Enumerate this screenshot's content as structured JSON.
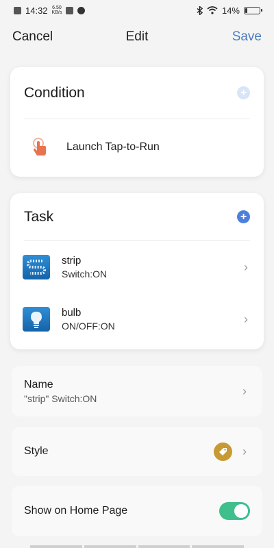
{
  "status_bar": {
    "time": "14:32",
    "net_speed_value": "6.50",
    "net_speed_unit": "KB/s",
    "battery": "14%"
  },
  "nav": {
    "cancel_label": "Cancel",
    "title": "Edit",
    "save_label": "Save"
  },
  "condition": {
    "title": "Condition",
    "item_label": "Launch Tap-to-Run"
  },
  "task": {
    "title": "Task",
    "items": [
      {
        "name": "strip",
        "sub": "Switch:ON",
        "icon": "led-strip-icon"
      },
      {
        "name": "bulb",
        "sub": "ON/OFF:ON",
        "icon": "bulb-icon"
      }
    ]
  },
  "name_row": {
    "title": "Name",
    "value": "\"strip\" Switch:ON"
  },
  "style_row": {
    "title": "Style",
    "icon": "tag-icon"
  },
  "home_row": {
    "title": "Show on Home Page",
    "toggle_on": true
  },
  "colors": {
    "accent_blue": "#4a7ec2",
    "plus_blue": "#4d7fdc",
    "toggle_green": "#3fbf8c",
    "tag_gold": "#c89a33",
    "tap_orange": "#e8734f"
  }
}
